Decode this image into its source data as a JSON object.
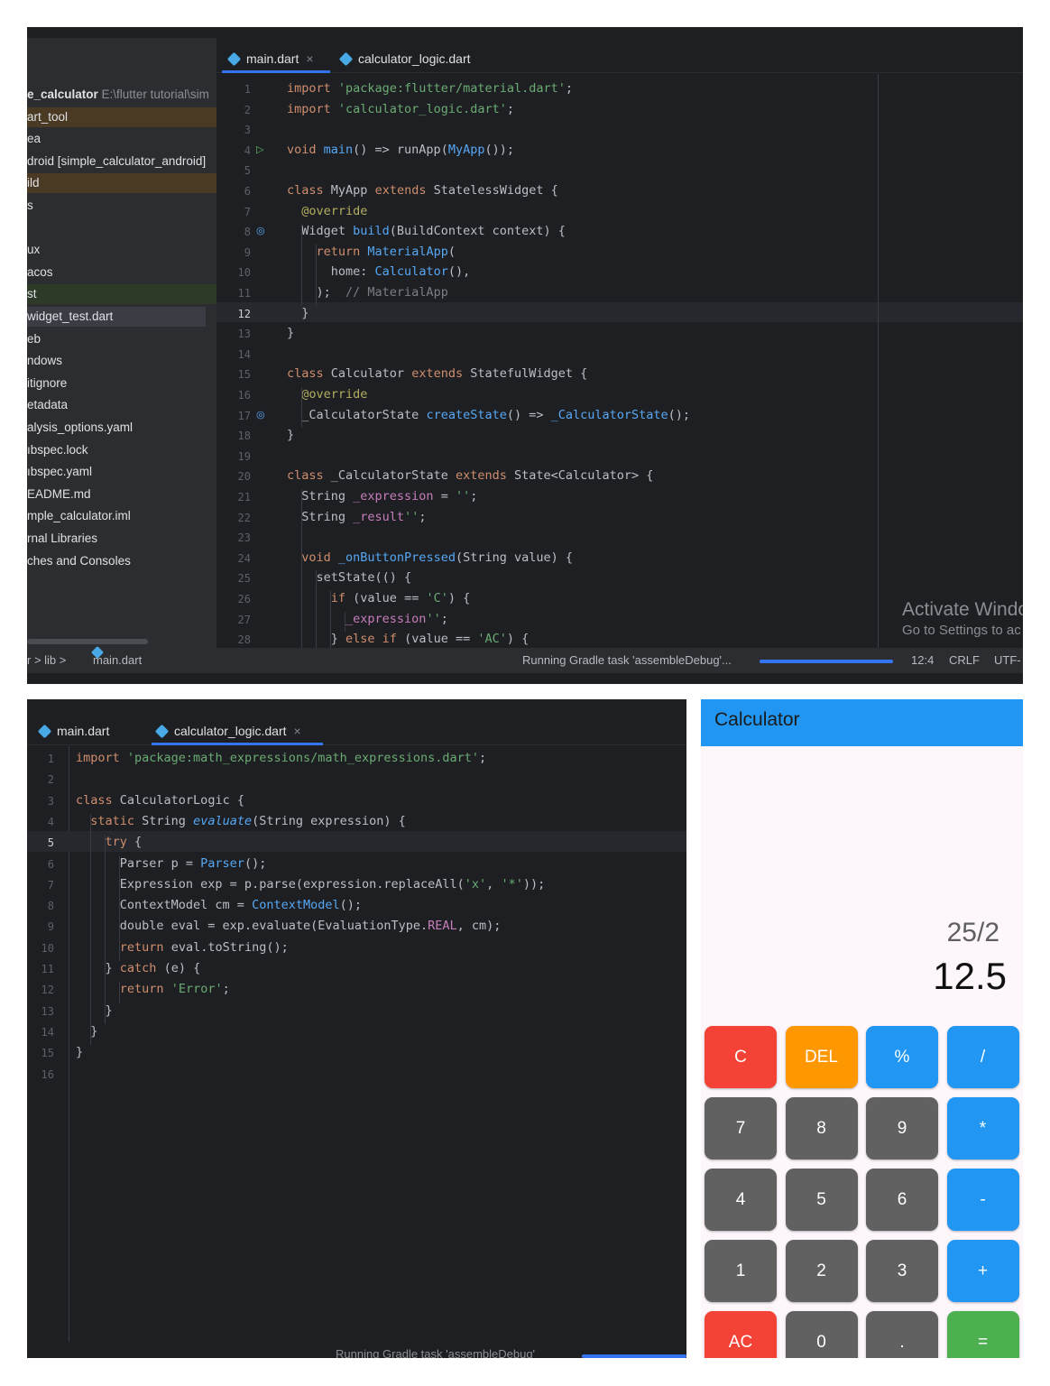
{
  "top_ide": {
    "sidebar": [
      {
        "label": "e_calculator",
        "dim": " E:\\flutter tutorial\\sim",
        "hl": "",
        "bold": true
      },
      {
        "label": "art_tool",
        "dim": "",
        "hl": "orange"
      },
      {
        "label": "ea",
        "dim": "",
        "hl": ""
      },
      {
        "label": "droid [simple_calculator_android]",
        "dim": "",
        "hl": ""
      },
      {
        "label": "ild",
        "dim": "",
        "hl": "orange"
      },
      {
        "label": "s",
        "dim": "",
        "hl": ""
      },
      {
        "label": "",
        "dim": "",
        "hl": ""
      },
      {
        "label": "ux",
        "dim": "",
        "hl": ""
      },
      {
        "label": "acos",
        "dim": "",
        "hl": ""
      },
      {
        "label": "st",
        "dim": "",
        "hl": "green"
      },
      {
        "label": " widget_test.dart",
        "dim": "",
        "hl": "selected"
      },
      {
        "label": "eb",
        "dim": "",
        "hl": ""
      },
      {
        "label": "ndows",
        "dim": "",
        "hl": ""
      },
      {
        "label": "itignore",
        "dim": "",
        "hl": ""
      },
      {
        "label": "etadata",
        "dim": "",
        "hl": ""
      },
      {
        "label": "alysis_options.yaml",
        "dim": "",
        "hl": ""
      },
      {
        "label": "ıbspec.lock",
        "dim": "",
        "hl": ""
      },
      {
        "label": "ıbspec.yaml",
        "dim": "",
        "hl": ""
      },
      {
        "label": "EADME.md",
        "dim": "",
        "hl": ""
      },
      {
        "label": "mple_calculator.iml",
        "dim": "",
        "hl": ""
      },
      {
        "label": "rnal Libraries",
        "dim": "",
        "hl": ""
      },
      {
        "label": "ches and Consoles",
        "dim": "",
        "hl": ""
      }
    ],
    "tabs": [
      {
        "label": "main.dart",
        "close": "×",
        "active": true
      },
      {
        "label": "calculator_logic.dart",
        "close": "",
        "active": false
      }
    ],
    "current_line": 12,
    "code": [
      [
        [
          "kw",
          "import "
        ],
        [
          "str",
          "'package:flutter/material.dart'"
        ],
        [
          "",
          "; "
        ]
      ],
      [
        [
          "kw",
          "import "
        ],
        [
          "str",
          "'calculator_logic.dart'"
        ],
        [
          "",
          ";"
        ]
      ],
      [],
      [
        [
          "kw",
          "void "
        ],
        [
          "fn",
          "main"
        ],
        [
          "",
          "() => runApp("
        ],
        [
          "fn",
          "MyApp"
        ],
        [
          "",
          "());"
        ]
      ],
      [],
      [
        [
          "kw",
          "class "
        ],
        [
          "",
          "MyApp "
        ],
        [
          "kw",
          "extends "
        ],
        [
          "",
          "StatelessWidget {"
        ]
      ],
      [
        [
          "",
          "  "
        ],
        [
          "ann",
          "@override"
        ]
      ],
      [
        [
          "",
          "  Widget "
        ],
        [
          "fn",
          "build"
        ],
        [
          "",
          "(BuildContext context) {"
        ]
      ],
      [
        [
          "",
          "    "
        ],
        [
          "kw",
          "return "
        ],
        [
          "fn",
          "MaterialApp"
        ],
        [
          "",
          "("
        ]
      ],
      [
        [
          "",
          "      home: "
        ],
        [
          "fn",
          "Calculator"
        ],
        [
          "",
          "(),"
        ]
      ],
      [
        [
          "",
          "    );  "
        ],
        [
          "cmt",
          "// MaterialApp"
        ]
      ],
      [
        [
          "",
          "  }"
        ]
      ],
      [
        [
          "",
          "}"
        ]
      ],
      [],
      [
        [
          "kw",
          "class "
        ],
        [
          "",
          "Calculator "
        ],
        [
          "kw",
          "extends "
        ],
        [
          "",
          "StatefulWidget {"
        ]
      ],
      [
        [
          "",
          "  "
        ],
        [
          "ann",
          "@override"
        ]
      ],
      [
        [
          "",
          "  _CalculatorState "
        ],
        [
          "fn",
          "createState"
        ],
        [
          "",
          "() => "
        ],
        [
          "fn",
          "_CalculatorState"
        ],
        [
          "",
          "();"
        ]
      ],
      [
        [
          "",
          "}"
        ]
      ],
      [],
      [
        [
          "kw",
          "class "
        ],
        [
          "",
          "_CalculatorState "
        ],
        [
          "kw",
          "extends "
        ],
        [
          "",
          "State<Calculator> {"
        ]
      ],
      [
        [
          "",
          "  String "
        ],
        [
          "lead",
          "_expression"
        ],
        [
          "",
          " = "
        ],
        [
          "str",
          "''"
        ],
        [
          "",
          ";"
        ]
      ],
      [
        [
          "",
          "  String "
        ],
        [
          "lead",
          "_result"
        ],
        [
          "",
          "",
          " = "
        ],
        [
          "str",
          "''"
        ],
        [
          "",
          ";"
        ]
      ],
      [],
      [
        [
          "",
          "  "
        ],
        [
          "kw",
          "void "
        ],
        [
          "fn",
          "_onButtonPressed"
        ],
        [
          "",
          "(String value) {"
        ]
      ],
      [
        [
          "",
          "    setState(() {"
        ]
      ],
      [
        [
          "",
          "      "
        ],
        [
          "kw",
          "if "
        ],
        [
          "",
          "(value == "
        ],
        [
          "str",
          "'C'"
        ],
        [
          "",
          ") {"
        ]
      ],
      [
        [
          "",
          "        "
        ],
        [
          "lead",
          "_expression"
        ],
        [
          "",
          "",
          " = "
        ],
        [
          "str",
          "''"
        ],
        [
          "",
          ";"
        ]
      ],
      [
        [
          "",
          "      } "
        ],
        [
          "kw",
          "else if "
        ],
        [
          "",
          "(value == "
        ],
        [
          "str",
          "'AC'"
        ],
        [
          "",
          ") {"
        ]
      ]
    ],
    "watermark_title": "Activate Windo",
    "watermark_sub": "Go to Settings to ac",
    "breadcrumb": "r  >  lib  >",
    "breadcrumb_file": "main.dart",
    "status_task": "Running Gradle task 'assembleDebug'...",
    "progress_fraction": 1.0,
    "caret_pos": "12:4",
    "line_sep": "CRLF",
    "encoding": "UTF-"
  },
  "bottom_ide": {
    "tabs": [
      {
        "label": "main.dart",
        "close": "",
        "active": false
      },
      {
        "label": "calculator_logic.dart",
        "close": "×",
        "active": true
      }
    ],
    "current_line": 5,
    "code": [
      [
        [
          "kw",
          "import "
        ],
        [
          "str",
          "'package:math_expressions/math_expressions.dart'"
        ],
        [
          "",
          ";"
        ]
      ],
      [],
      [
        [
          "kw",
          "class "
        ],
        [
          "",
          "CalculatorLogic {"
        ]
      ],
      [
        [
          "",
          "  "
        ],
        [
          "kw",
          "static "
        ],
        [
          "",
          "String "
        ],
        [
          "ital",
          "evaluate"
        ],
        [
          "",
          "(String expression) {"
        ]
      ],
      [
        [
          "",
          "    "
        ],
        [
          "kw",
          "try "
        ],
        [
          "",
          "{"
        ]
      ],
      [
        [
          "",
          "      Parser p = "
        ],
        [
          "fn",
          "Parser"
        ],
        [
          "",
          "();"
        ]
      ],
      [
        [
          "",
          "      Expression exp = p.parse(expression.replaceAll("
        ],
        [
          "str",
          "'x'"
        ],
        [
          "",
          ", "
        ],
        [
          "str",
          "'*'"
        ],
        [
          "",
          "));"
        ]
      ],
      [
        [
          "",
          "      ContextModel cm = "
        ],
        [
          "fn",
          "ContextModel"
        ],
        [
          "",
          "();"
        ]
      ],
      [
        [
          "",
          "      double eval = exp.evaluate(EvaluationType."
        ],
        [
          "lead",
          "REAL"
        ],
        [
          "",
          ", cm);"
        ]
      ],
      [
        [
          "",
          "      "
        ],
        [
          "kw",
          "return "
        ],
        [
          "",
          "eval.toString();"
        ]
      ],
      [
        [
          "",
          "    } "
        ],
        [
          "kw",
          "catch "
        ],
        [
          "",
          "(e) {"
        ]
      ],
      [
        [
          "",
          "      "
        ],
        [
          "kw",
          "return "
        ],
        [
          "str",
          "'Error'"
        ],
        [
          "",
          ";"
        ]
      ],
      [
        [
          "",
          "    }"
        ]
      ],
      [
        [
          "",
          "  }"
        ]
      ],
      [
        [
          "",
          "}"
        ]
      ],
      []
    ],
    "status_task": "Running Gradle task 'assembleDebug'"
  },
  "calculator": {
    "title": "Calculator",
    "expression": "25/2",
    "result": "12.5",
    "buttons": [
      [
        {
          "label": "C",
          "color": "red"
        },
        {
          "label": "DEL",
          "color": "orange"
        },
        {
          "label": "%",
          "color": "blue"
        },
        {
          "label": "/",
          "color": "blue"
        }
      ],
      [
        {
          "label": "7",
          "color": "grey"
        },
        {
          "label": "8",
          "color": "grey"
        },
        {
          "label": "9",
          "color": "grey"
        },
        {
          "label": "*",
          "color": "blue"
        }
      ],
      [
        {
          "label": "4",
          "color": "grey"
        },
        {
          "label": "5",
          "color": "grey"
        },
        {
          "label": "6",
          "color": "grey"
        },
        {
          "label": "-",
          "color": "blue"
        }
      ],
      [
        {
          "label": "1",
          "color": "grey"
        },
        {
          "label": "2",
          "color": "grey"
        },
        {
          "label": "3",
          "color": "grey"
        },
        {
          "label": "+",
          "color": "blue"
        }
      ],
      [
        {
          "label": "AC",
          "color": "red"
        },
        {
          "label": "0",
          "color": "grey"
        },
        {
          "label": ".",
          "color": "grey"
        },
        {
          "label": "=",
          "color": "green"
        }
      ]
    ],
    "colors": {
      "appbar": "#2196f3",
      "red": "#f44336",
      "orange": "#ff9800",
      "blue": "#2196f3",
      "grey": "#616161",
      "green": "#4caf50"
    }
  }
}
